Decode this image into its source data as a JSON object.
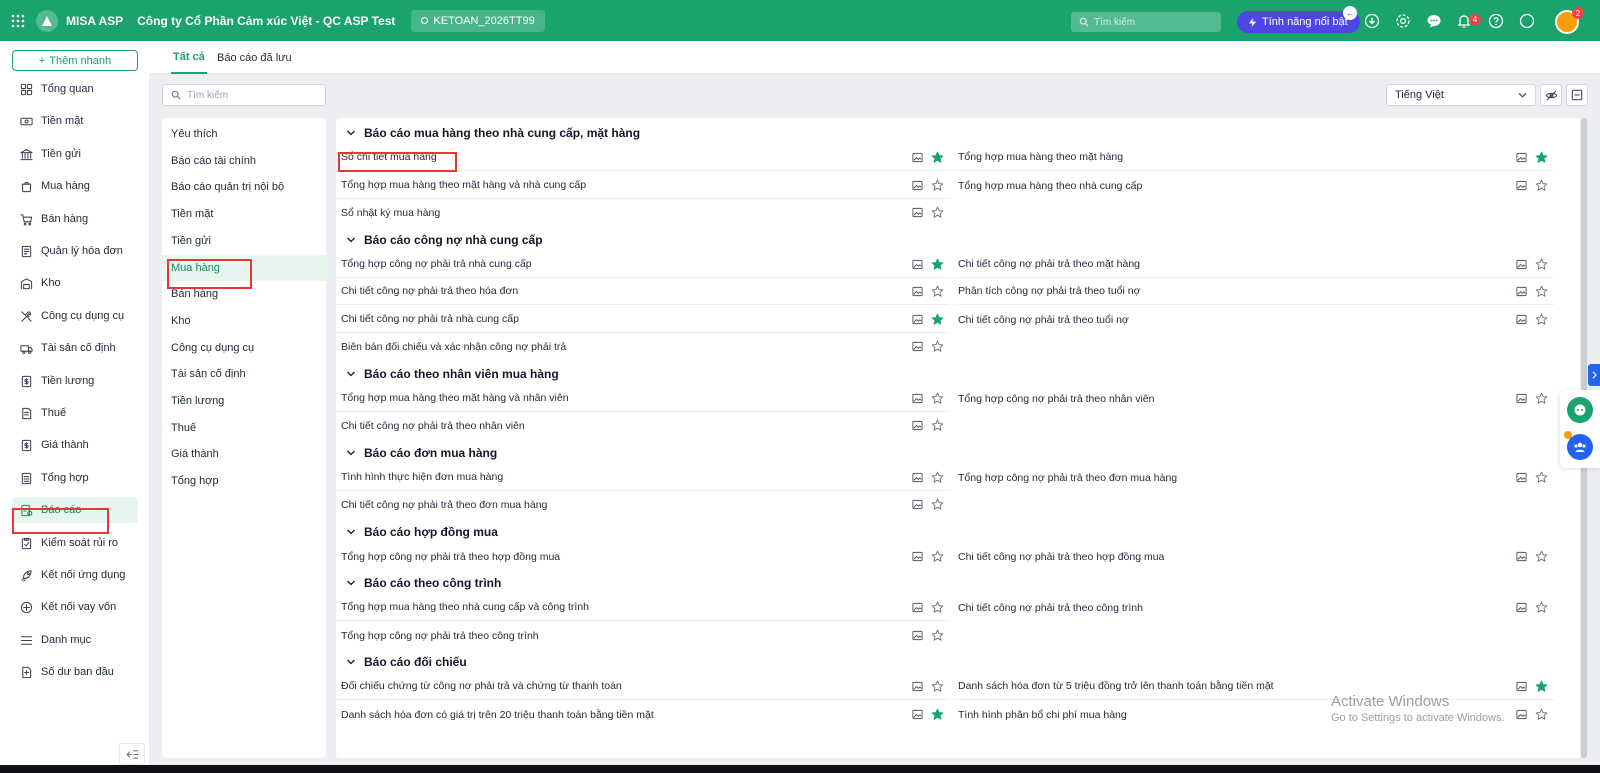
{
  "topbar": {
    "app_name": "MISA ASP",
    "company": "Công ty Cổ Phần Cảm xúc Việt - QC ASP Test",
    "database": "KETOAN_2026TT99",
    "search_placeholder": "Tìm kiếm",
    "feature_button": "Tính năng nổi bật",
    "notifications_count": "4",
    "avatar_badge": "2",
    "colors": {
      "bar": "#1aa36c",
      "feature": "#4f46e5"
    }
  },
  "sidebar": {
    "quick_add": "Thêm nhanh",
    "items": [
      {
        "label": "Tổng quan",
        "icon": "dashboard-icon"
      },
      {
        "label": "Tiền mặt",
        "icon": "cash-icon"
      },
      {
        "label": "Tiền gửi",
        "icon": "bank-icon"
      },
      {
        "label": "Mua hàng",
        "icon": "shopping-bag-icon"
      },
      {
        "label": "Bán hàng",
        "icon": "cart-icon"
      },
      {
        "label": "Quản lý hóa đơn",
        "icon": "invoice-icon"
      },
      {
        "label": "Kho",
        "icon": "warehouse-icon"
      },
      {
        "label": "Công cụ dụng cụ",
        "icon": "tools-icon"
      },
      {
        "label": "Tài sản cố định",
        "icon": "truck-icon"
      },
      {
        "label": "Tiền lương",
        "icon": "salary-icon"
      },
      {
        "label": "Thuế",
        "icon": "tax-icon"
      },
      {
        "label": "Giá thành",
        "icon": "cost-icon"
      },
      {
        "label": "Tổng hợp",
        "icon": "summary-icon"
      },
      {
        "label": "Báo cáo",
        "icon": "report-icon"
      },
      {
        "label": "Kiểm soát rủi ro",
        "icon": "risk-icon"
      },
      {
        "label": "Kết nối ứng dụng",
        "icon": "rocket-icon"
      },
      {
        "label": "Kết nối vay vốn",
        "icon": "loan-icon"
      },
      {
        "label": "Danh mục",
        "icon": "list-icon"
      },
      {
        "label": "Số dư ban đầu",
        "icon": "opening-balance-icon"
      }
    ],
    "active": "Báo cáo"
  },
  "tabs": [
    {
      "label": "Tất cả",
      "active": true
    },
    {
      "label": "Báo cáo đã lưu",
      "active": false
    }
  ],
  "filter": {
    "search_placeholder": "Tìm kiếm",
    "language": "Tiếng Việt"
  },
  "categories": {
    "items": [
      "Yêu thích",
      "Báo cáo tài chính",
      "Báo cáo quản trị nội bộ",
      "Tiền mặt",
      "Tiền gửi",
      "Mua hàng",
      "Bán hàng",
      "Kho",
      "Công cụ dụng cụ",
      "Tài sản cố định",
      "Tiền lương",
      "Thuế",
      "Giá thành",
      "Tổng hợp"
    ],
    "active": "Mua hàng"
  },
  "groups": [
    {
      "title": "Báo cáo mua hàng theo nhà cung cấp, mặt hàng",
      "rows": [
        {
          "left": {
            "name": "Sổ chi tiết mua hàng",
            "starred": true
          },
          "right": {
            "name": "Tổng hợp mua hàng theo mặt hàng",
            "starred": true
          }
        },
        {
          "left": {
            "name": "Tổng hợp mua hàng theo mặt hàng và nhà cung cấp",
            "starred": false
          },
          "right": {
            "name": "Tổng hợp mua hàng theo nhà cung cấp",
            "starred": false
          }
        },
        {
          "left": {
            "name": "Sổ nhật ký mua hàng",
            "starred": false
          },
          "right": null
        }
      ]
    },
    {
      "title": "Báo cáo công nợ nhà cung cấp",
      "rows": [
        {
          "left": {
            "name": "Tổng hợp công nợ phải trả nhà cung cấp",
            "starred": true
          },
          "right": {
            "name": "Chi tiết công nợ phải trả theo mặt hàng",
            "starred": false
          }
        },
        {
          "left": {
            "name": "Chi tiết công nợ phải trả theo hóa đơn",
            "starred": false
          },
          "right": {
            "name": "Phân tích công nợ phải trả theo tuổi nợ",
            "starred": false
          }
        },
        {
          "left": {
            "name": "Chi tiết công nợ phải trả nhà cung cấp",
            "starred": true
          },
          "right": {
            "name": "Chi tiết công nợ phải trả theo tuổi nợ",
            "starred": false
          }
        },
        {
          "left": {
            "name": "Biên bản đối chiếu và xác nhận công nợ phải trả",
            "starred": false
          },
          "right": null
        }
      ]
    },
    {
      "title": "Báo cáo theo nhân viên mua hàng",
      "rows": [
        {
          "left": {
            "name": "Tổng hợp mua hàng theo mặt hàng và nhân viên",
            "starred": false
          },
          "right": {
            "name": "Tổng hợp công nợ phải trả theo nhân viên",
            "starred": false
          }
        },
        {
          "left": {
            "name": "Chi tiết công nợ phải trả theo nhân viên",
            "starred": false
          },
          "right": null
        }
      ]
    },
    {
      "title": "Báo cáo đơn mua hàng",
      "rows": [
        {
          "left": {
            "name": "Tình hình thực hiện đơn mua hàng",
            "starred": false
          },
          "right": {
            "name": "Tổng hợp công nợ phải trả theo đơn mua hàng",
            "starred": false
          }
        },
        {
          "left": {
            "name": "Chi tiết công nợ phải trả theo đơn mua hàng",
            "starred": false
          },
          "right": null
        }
      ]
    },
    {
      "title": "Báo cáo hợp đồng mua",
      "rows": [
        {
          "left": {
            "name": "Tổng hợp công nợ phải trả theo hợp đồng mua",
            "starred": false
          },
          "right": {
            "name": "Chi tiết công nợ phải trả theo hợp đồng mua",
            "starred": false
          }
        }
      ]
    },
    {
      "title": "Báo cáo theo công trình",
      "rows": [
        {
          "left": {
            "name": "Tổng hợp mua hàng theo nhà cung cấp và công trình",
            "starred": false
          },
          "right": {
            "name": "Chi tiết công nợ phải trả theo công trình",
            "starred": false
          }
        },
        {
          "left": {
            "name": "Tổng hợp công nợ phải trả theo công trình",
            "starred": false
          },
          "right": null
        }
      ]
    },
    {
      "title": "Báo cáo đối chiếu",
      "rows": [
        {
          "left": {
            "name": "Đối chiếu chứng từ công nợ phải trả và chứng từ thanh toán",
            "starred": false
          },
          "right": {
            "name": "Danh sách hóa đơn từ 5 triệu đồng trở lên thanh toán bằng tiền mặt",
            "starred": true
          }
        },
        {
          "left": {
            "name": "Danh sách hóa đơn có giá trị trên 20 triệu thanh toán bằng tiền mặt",
            "starred": true
          },
          "right": {
            "name": "Tình hình phân bổ chi phí mua hàng",
            "starred": false
          }
        }
      ]
    }
  ],
  "watermark": {
    "line1": "Activate Windows",
    "line2": "Go to Settings to activate Windows."
  },
  "colors": {
    "accent": "#1aa36c",
    "star_on": "#1aa36c",
    "highlight": "#e53935"
  }
}
